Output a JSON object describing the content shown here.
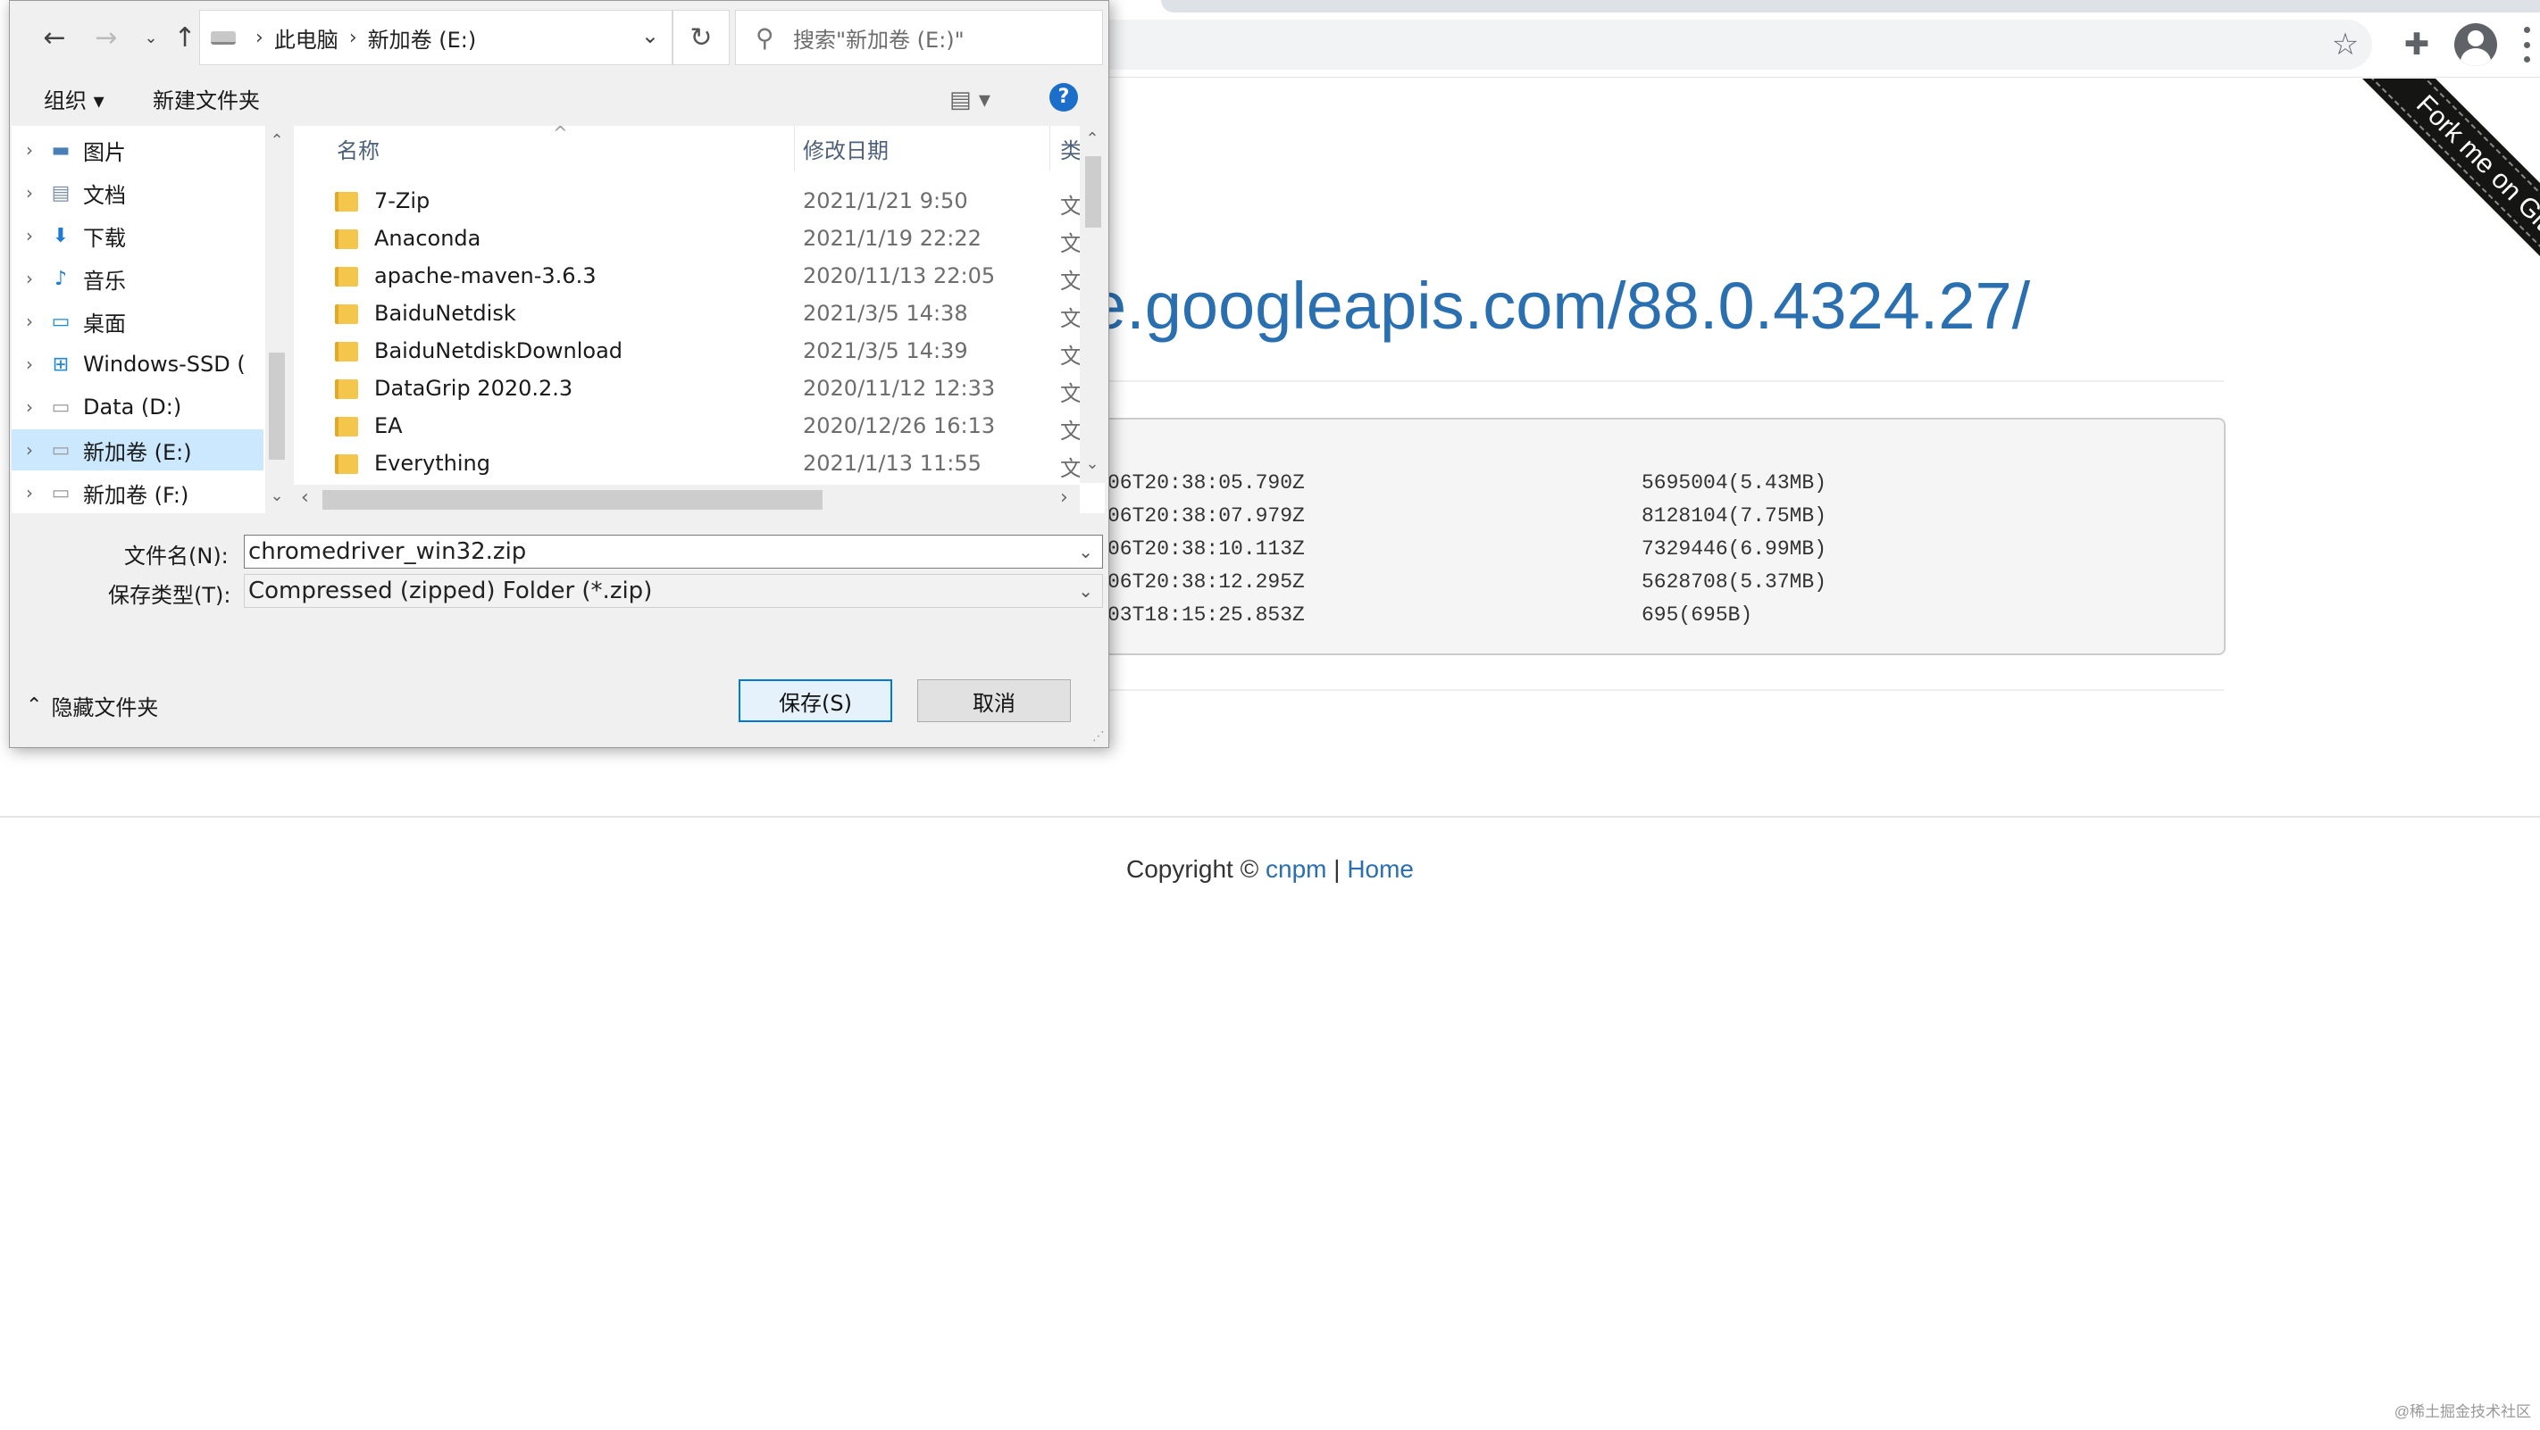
{
  "browser": {
    "ribbon_text": "Fork me on GitHub",
    "url_title": "e.googleapis.com/88.0.4324.27/",
    "files": [
      {
        "date": "06T20:38:05.790Z",
        "size": "5695004(5.43MB)"
      },
      {
        "date": "06T20:38:07.979Z",
        "size": "8128104(7.75MB)"
      },
      {
        "date": "06T20:38:10.113Z",
        "size": "7329446(6.99MB)"
      },
      {
        "date": "06T20:38:12.295Z",
        "size": "5628708(5.37MB)"
      },
      {
        "date": "03T18:15:25.853Z",
        "size": "695(695B)"
      }
    ],
    "footer": {
      "copyright": "Copyright ©",
      "link1": "cnpm",
      "sep": "|",
      "link2": "Home"
    },
    "watermark": "@稀土掘金技术社区"
  },
  "dialog": {
    "breadcrumb": [
      "此电脑",
      "新加卷 (E:)"
    ],
    "search_placeholder": "搜索\"新加卷 (E:)\"",
    "commands": {
      "organize": "组织 ▾",
      "new_folder": "新建文件夹",
      "help": "?"
    },
    "nav_items": [
      {
        "label": "图片",
        "icon": "▬"
      },
      {
        "label": "文档",
        "icon": "▤"
      },
      {
        "label": "下载",
        "icon": "⬇"
      },
      {
        "label": "音乐",
        "icon": "♪"
      },
      {
        "label": "桌面",
        "icon": "▭"
      },
      {
        "label": "Windows-SSD (",
        "icon": "⊞"
      },
      {
        "label": "Data (D:)",
        "icon": "▭"
      },
      {
        "label": "新加卷 (E:)",
        "icon": "▭"
      },
      {
        "label": "新加卷 (F:)",
        "icon": "▭"
      }
    ],
    "columns": {
      "name": "名称",
      "date": "修改日期",
      "type": "类"
    },
    "files": [
      {
        "name": "7-Zip",
        "date": "2021/1/21 9:50",
        "type": "文"
      },
      {
        "name": "Anaconda",
        "date": "2021/1/19 22:22",
        "type": "文"
      },
      {
        "name": "apache-maven-3.6.3",
        "date": "2020/11/13 22:05",
        "type": "文"
      },
      {
        "name": "BaiduNetdisk",
        "date": "2021/3/5 14:38",
        "type": "文"
      },
      {
        "name": "BaiduNetdiskDownload",
        "date": "2021/3/5 14:39",
        "type": "文"
      },
      {
        "name": "DataGrip 2020.2.3",
        "date": "2020/11/12 12:33",
        "type": "文"
      },
      {
        "name": "EA",
        "date": "2020/12/26 16:13",
        "type": "文"
      },
      {
        "name": "Everything",
        "date": "2021/1/13 11:55",
        "type": "文"
      }
    ],
    "filename_label": "文件名(N):",
    "filename_value": "chromedriver_win32.zip",
    "filetype_label": "保存类型(T):",
    "filetype_value": "Compressed (zipped) Folder (*.zip)",
    "hide_folders": "隐藏文件夹",
    "save_button": "保存(S)",
    "cancel_button": "取消"
  }
}
